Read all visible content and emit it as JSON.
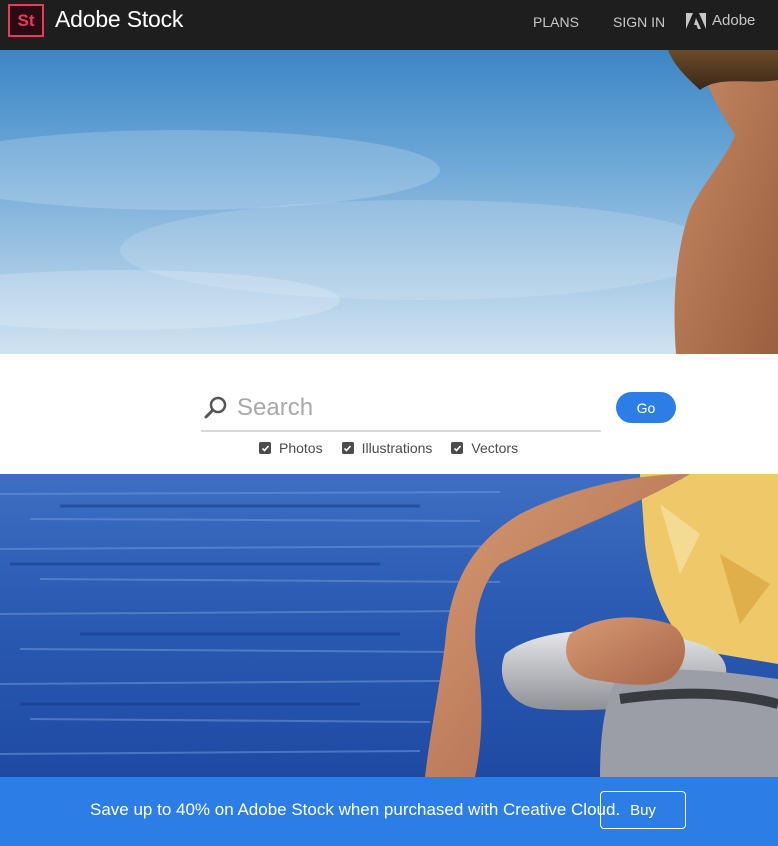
{
  "header": {
    "logo_text": "St",
    "brand": "Adobe Stock",
    "nav": {
      "plans": "PLANS",
      "sign_in": "SIGN IN",
      "adobe": "Adobe"
    }
  },
  "hero": {
    "top_description_icon": "hero-photo",
    "bottom_description_icon": "hero-photo"
  },
  "search": {
    "placeholder": "Search",
    "value": "",
    "go_label": "Go",
    "filters": [
      {
        "label": "Photos",
        "checked": true
      },
      {
        "label": "Illustrations",
        "checked": true
      },
      {
        "label": "Vectors",
        "checked": true
      }
    ]
  },
  "promo": {
    "text": "Save up to 40% on Adobe Stock when purchased with Creative Cloud.",
    "buy_label": "Buy"
  },
  "colors": {
    "topbar": "#1e1e1e",
    "brand_accent": "#e83a61",
    "primary_blue": "#2d7de6"
  }
}
